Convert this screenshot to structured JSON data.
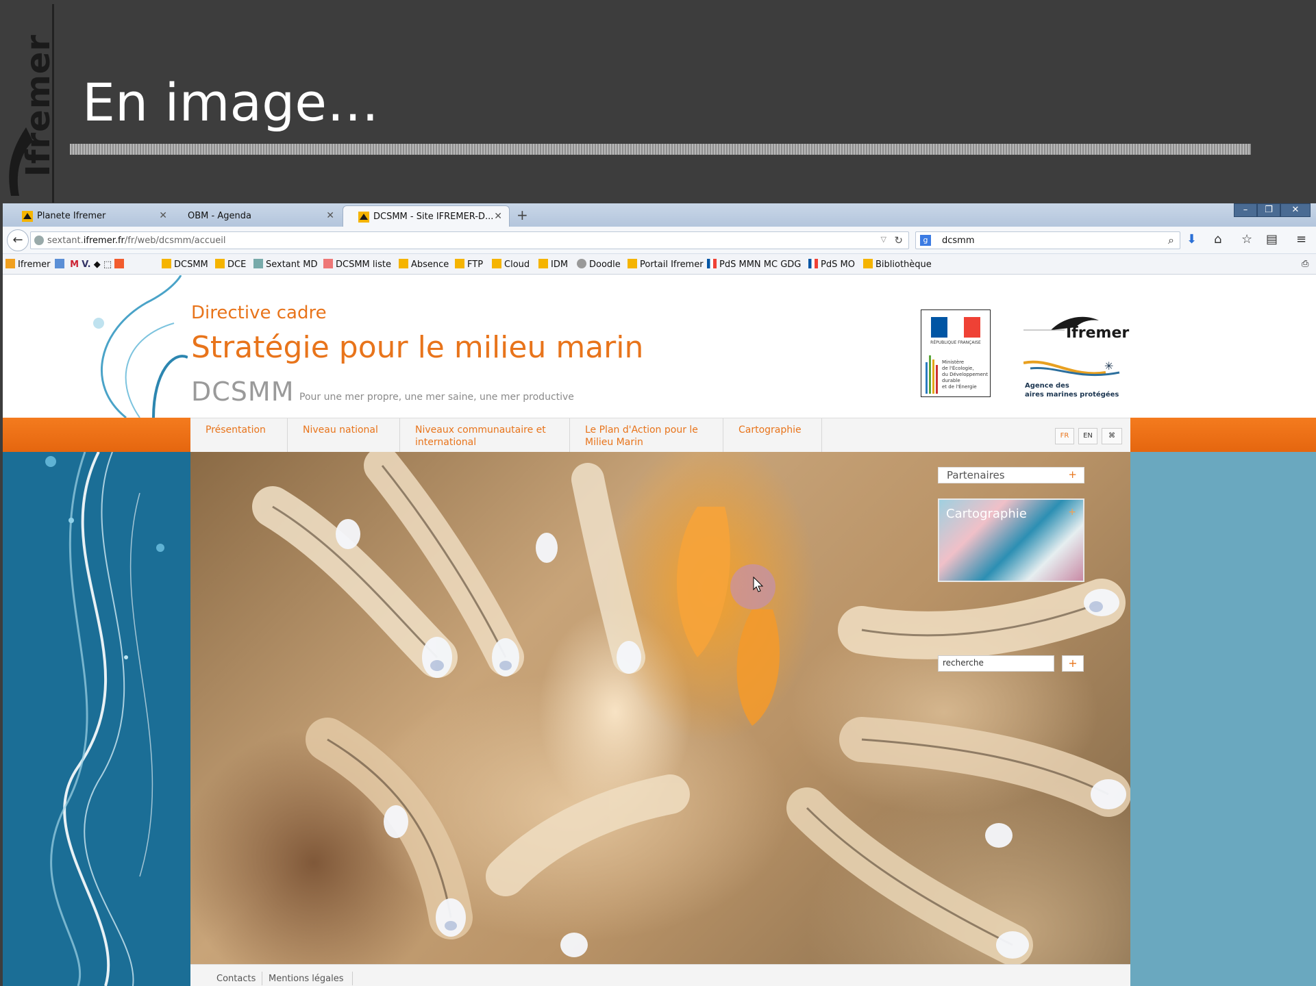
{
  "slide": {
    "logo_text": "Ifremer",
    "title": "En image…"
  },
  "browser": {
    "tabs": [
      {
        "label": "Planete Ifremer",
        "active": false
      },
      {
        "label": "OBM - Agenda",
        "active": false
      },
      {
        "label": "DCSMM - Site IFREMER-D...",
        "active": true
      }
    ],
    "new_tab": "+",
    "url": {
      "prefix": "sextant.",
      "host": "ifremer.fr",
      "path": "/fr/web/dcsmm/accueil"
    },
    "search": {
      "engine": "google",
      "value": "dcsmm"
    },
    "bookmarks": [
      "Ifremer",
      "DCSMM",
      "DCE",
      "Sextant MD",
      "DCSMM liste",
      "Absence",
      "FTP",
      "Cloud",
      "IDM",
      "Doodle",
      "Portail Ifremer",
      "PdS MMN MC GDG",
      "PdS MO",
      "Bibliothèque"
    ]
  },
  "site": {
    "kicker": "Directive cadre",
    "title": "Stratégie pour le milieu marin",
    "acronym": "DCSMM",
    "tagline": "Pour une mer propre, une mer saine, une mer productive",
    "partner_logos": {
      "gov": {
        "line1": "RÉPUBLIQUE FRANÇAISE",
        "ministry": [
          "Ministère",
          "de l'Écologie,",
          "du Développement",
          "durable",
          "et de l'Énergie"
        ]
      },
      "ifremer": "Ifremer",
      "amp": {
        "line1": "Agence des",
        "line2": "aires marines protégées"
      }
    },
    "menu": [
      {
        "label": "Présentation"
      },
      {
        "label": "Niveau national"
      },
      {
        "label": "Niveaux communautaire et international"
      },
      {
        "label": "Le Plan d'Action pour le Milieu Marin"
      },
      {
        "label": "Cartographie"
      }
    ],
    "languages": [
      "FR",
      "EN"
    ],
    "sidebar": {
      "partners_label": "Partenaires",
      "carto_label": "Cartographie",
      "plus": "+",
      "search_value": "recherche"
    },
    "footer": [
      "Contacts",
      "Mentions légales"
    ],
    "colors": {
      "accent": "#e8741b",
      "left_panel": "#1b6e96",
      "right_panel": "#6aa8bf"
    }
  }
}
